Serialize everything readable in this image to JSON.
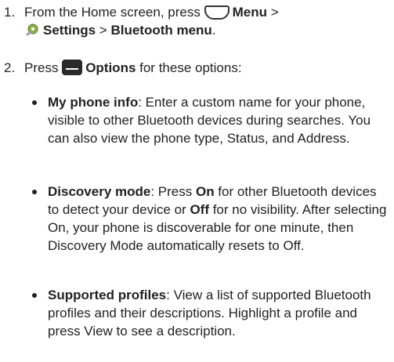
{
  "steps": [
    {
      "number": "1.",
      "line1_pre": "From the Home screen, press",
      "menu_label": "Menu",
      "line1_post": " >",
      "settings_label": "Settings",
      "sep": " > ",
      "bluetooth_label": "Bluetooth menu",
      "end": "."
    },
    {
      "number": "2.",
      "pre": "Press ",
      "options_label": "Options",
      "post": " for these options:"
    }
  ],
  "options": [
    {
      "title": "My phone info",
      "text": ": Enter a custom name for your phone, visible to other Bluetooth devices during searches. You can also view the phone type, Status, and Address."
    },
    {
      "title": "Discovery mode",
      "t1": ": Press ",
      "on_label": "On",
      "t2": " for other Bluetooth devices to detect your device or ",
      "off_label": "Off",
      "t3": " for no visibility. After selecting On, your phone is discoverable for one minute, then Discovery Mode automatically resets to Off."
    },
    {
      "title": "Supported profiles",
      "text": ": View a list of supported Bluetooth profiles and their descriptions. Highlight a profile and press View to see a description."
    }
  ],
  "icons": {
    "menu_key": "menu-key-icon",
    "options_key": "options-key-icon",
    "settings": "settings-gear-icon"
  }
}
